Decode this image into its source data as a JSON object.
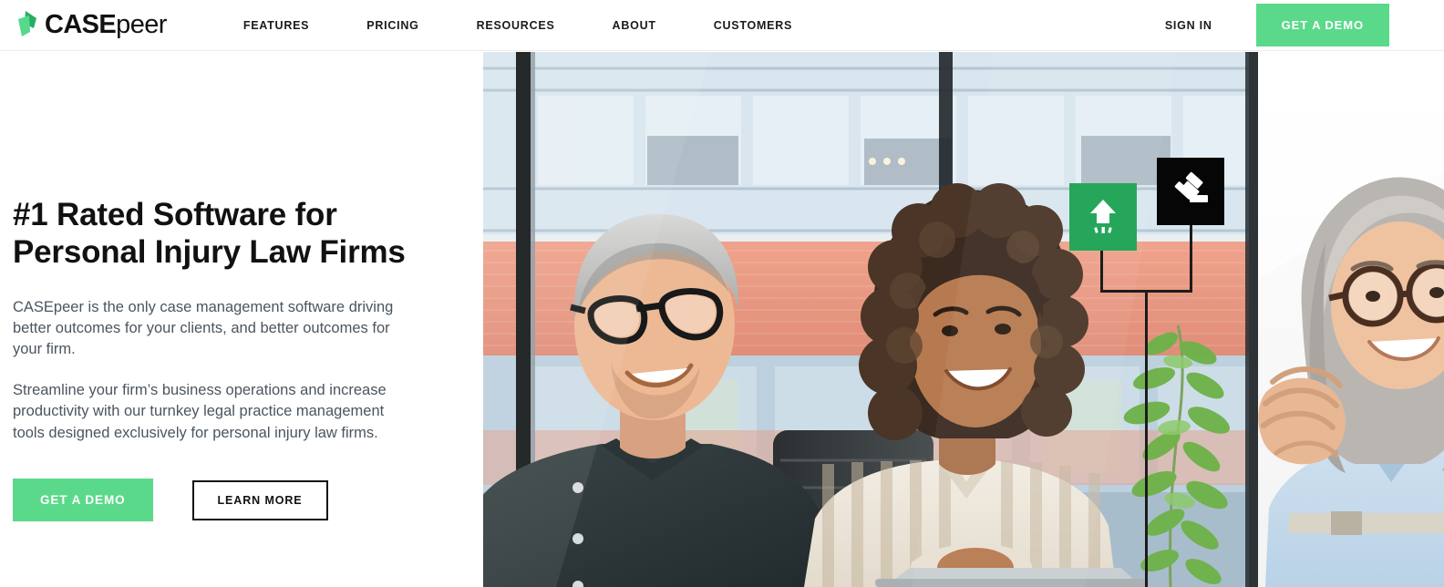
{
  "brand": {
    "name_bold": "CASE",
    "name_light": "peer",
    "logo_icon": "casepeer-leaf-logo",
    "colors": {
      "dark_green": "#27ae60",
      "light_green": "#55d98a"
    }
  },
  "header": {
    "nav_items": [
      {
        "label": "FEATURES"
      },
      {
        "label": "PRICING"
      },
      {
        "label": "RESOURCES"
      },
      {
        "label": "ABOUT"
      },
      {
        "label": "CUSTOMERS"
      }
    ],
    "sign_in_label": "SIGN IN",
    "demo_button_label": "GET A DEMO",
    "accent_color": "#5bd98a"
  },
  "hero": {
    "headline_line1": "#1 Rated Software for",
    "headline_line2": "Personal Injury Law Firms",
    "paragraph1": "CASEpeer is the only case management software driving better outcomes for your clients, and better outcomes for your firm.",
    "paragraph2": "Streamline your firm’s business operations and increase productivity with our turnkey legal practice management tools designed exclusively for personal injury law firms.",
    "primary_cta_label": "GET A DEMO",
    "secondary_cta_label": "LEARN MORE",
    "image_description": "Three colleagues smiling in a bright modern office beside floor-to-ceiling windows",
    "badges": [
      {
        "icon": "growth-arrow-icon",
        "background": "#26a65b"
      },
      {
        "icon": "gavel-icon",
        "background": "#060606"
      }
    ]
  }
}
